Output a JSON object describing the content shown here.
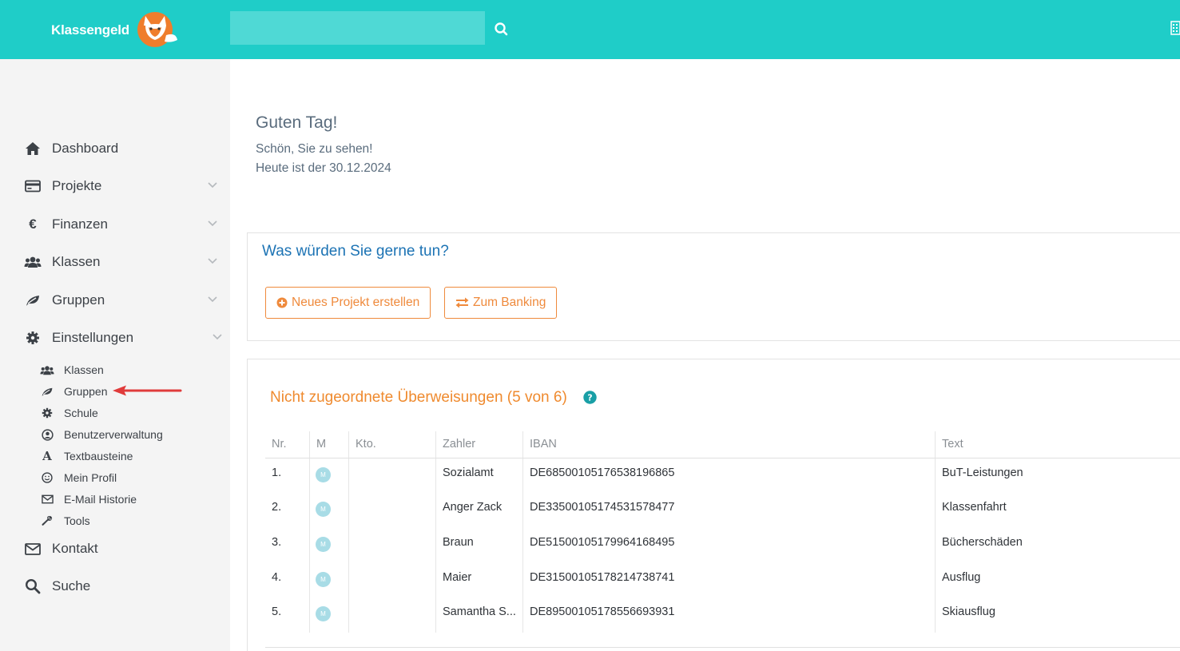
{
  "app": {
    "logo_text": "Klassengeld"
  },
  "search": {
    "placeholder": ""
  },
  "sidebar": {
    "items": [
      {
        "label": "Dashboard",
        "icon": "home-icon"
      },
      {
        "label": "Projekte",
        "icon": "credit-card-icon"
      },
      {
        "label": "Finanzen",
        "icon": "euro-icon"
      },
      {
        "label": "Klassen",
        "icon": "users-icon"
      },
      {
        "label": "Gruppen",
        "icon": "leaf-icon"
      },
      {
        "label": "Einstellungen",
        "icon": "gear-icon"
      },
      {
        "label": "Kontakt",
        "icon": "envelope-icon"
      },
      {
        "label": "Suche",
        "icon": "search-icon"
      }
    ],
    "settings_sub": [
      {
        "label": "Klassen",
        "icon": "users-icon"
      },
      {
        "label": "Gruppen",
        "icon": "leaf-icon"
      },
      {
        "label": "Schule",
        "icon": "gear-icon"
      },
      {
        "label": "Benutzerverwaltung",
        "icon": "user-circle-icon"
      },
      {
        "label": "Textbausteine",
        "icon": "font-icon"
      },
      {
        "label": "Mein Profil",
        "icon": "smile-icon"
      },
      {
        "label": "E-Mail Historie",
        "icon": "envelope-icon"
      },
      {
        "label": "Tools",
        "icon": "wrench-icon"
      }
    ]
  },
  "greeting": {
    "title": "Guten Tag!",
    "subtitle": "Schön, Sie zu sehen!",
    "date_line": "Heute ist der 30.12.2024"
  },
  "actions": {
    "title": "Was würden Sie gerne tun?",
    "new_project": "Neues Projekt erstellen",
    "banking": "Zum Banking"
  },
  "transfers": {
    "title": "Nicht zugeordnete Überweisungen (5 von 6)",
    "columns": [
      "Nr.",
      "M",
      "Kto.",
      "Zahler",
      "IBAN",
      "Text"
    ],
    "badge_letter": "M",
    "rows": [
      {
        "nr": "1.",
        "kto": "",
        "zahler": "Sozialamt",
        "iban": "DE68500105176538196865",
        "text": "BuT-Leistungen"
      },
      {
        "nr": "2.",
        "kto": "",
        "zahler": "Anger Zack",
        "iban": "DE33500105174531578477",
        "text": "Klassenfahrt"
      },
      {
        "nr": "3.",
        "kto": "",
        "zahler": "Braun",
        "iban": "DE51500105179964168495",
        "text": "Bücherschäden"
      },
      {
        "nr": "4.",
        "kto": "",
        "zahler": "Maier",
        "iban": "DE31500105178214738741",
        "text": "Ausflug"
      },
      {
        "nr": "5.",
        "kto": "",
        "zahler": "Samantha S...",
        "iban": "DE89500105178556693931",
        "text": "Skiausflug"
      }
    ]
  },
  "colors": {
    "topbar": "#1fcdc8",
    "accent_orange": "#ef8a3c",
    "title_blue": "#1c73b4",
    "sidebar_bg": "#f4f4f4"
  }
}
